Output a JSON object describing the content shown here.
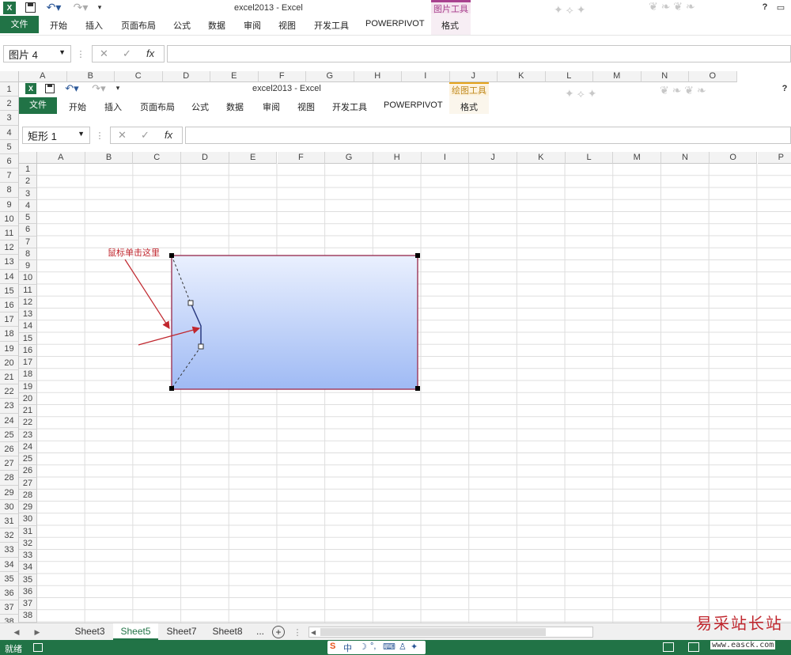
{
  "outer": {
    "title": "excel2013 - Excel",
    "context_tab_header": "图片工具",
    "context_tab": "格式",
    "tabs": [
      "开始",
      "插入",
      "页面布局",
      "公式",
      "数据",
      "审阅",
      "视图",
      "开发工具",
      "POWERPIVOT"
    ],
    "file_tab": "文件",
    "name_box": "图片 4",
    "columns": [
      "A",
      "B",
      "C",
      "D",
      "E",
      "F",
      "G",
      "H",
      "I",
      "J",
      "K",
      "L",
      "M",
      "N",
      "O"
    ],
    "rows": [
      "1",
      "2",
      "3",
      "4",
      "5",
      "6",
      "7",
      "8",
      "9",
      "10",
      "11",
      "12",
      "13",
      "14",
      "15",
      "16",
      "17",
      "18",
      "19",
      "20",
      "21",
      "22",
      "23",
      "24",
      "25",
      "26",
      "27",
      "28",
      "29",
      "30",
      "31",
      "32",
      "33",
      "34",
      "35",
      "36",
      "37",
      "38"
    ]
  },
  "inner": {
    "title": "excel2013 - Excel",
    "context_tab_header": "绘图工具",
    "context_tab": "格式",
    "tabs": [
      "开始",
      "插入",
      "页面布局",
      "公式",
      "数据",
      "审阅",
      "视图",
      "开发工具",
      "POWERPIVOT"
    ],
    "file_tab": "文件",
    "name_box": "矩形 1",
    "columns": [
      "A",
      "B",
      "C",
      "D",
      "E",
      "F",
      "G",
      "H",
      "I",
      "J",
      "K",
      "L",
      "M",
      "N",
      "O",
      "P"
    ],
    "rows": [
      "1",
      "2",
      "3",
      "4",
      "5",
      "6",
      "7",
      "8",
      "9",
      "10",
      "11",
      "12",
      "13",
      "14",
      "15",
      "16",
      "17",
      "18",
      "19",
      "20",
      "21",
      "22",
      "23",
      "24",
      "25",
      "26",
      "27",
      "28",
      "29",
      "30",
      "31",
      "32",
      "33",
      "34",
      "35",
      "36",
      "37",
      "38"
    ]
  },
  "annotation": "鼠标单击这里",
  "help": "?",
  "formula_icons": {
    "cancel": "✕",
    "enter": "✓",
    "fx": "fx"
  },
  "sheets": [
    "Sheet3",
    "Sheet5",
    "Sheet7",
    "Sheet8",
    "..."
  ],
  "active_sheet": "Sheet5",
  "status_text": "就绪",
  "watermark_cn": "易采站长站",
  "watermark_url": "www.easck.com",
  "colors": {
    "accent": "#217346",
    "context": "#a8418e",
    "drawing_tools": "#c08a1e",
    "shape_top": "#eaf0fe",
    "shape_bottom": "#9fbaf4",
    "shape_border": "#a04060",
    "arrow": "#c0262d"
  }
}
